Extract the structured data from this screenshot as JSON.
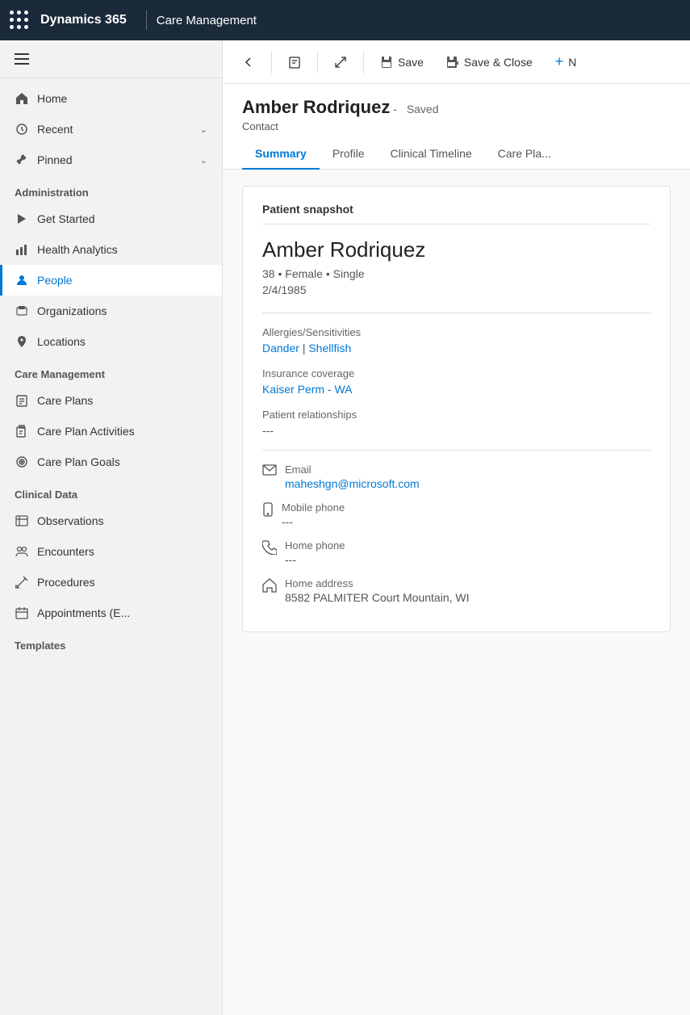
{
  "topbar": {
    "app_title": "Dynamics 365",
    "module_title": "Care Management"
  },
  "toolbar": {
    "back_label": "",
    "view_label": "",
    "expand_label": "",
    "save_label": "Save",
    "save_close_label": "Save & Close",
    "new_label": "N"
  },
  "record": {
    "name": "Amber Rodriquez",
    "status": "Saved",
    "type": "Contact"
  },
  "tabs": [
    {
      "id": "summary",
      "label": "Summary",
      "active": true
    },
    {
      "id": "profile",
      "label": "Profile",
      "active": false
    },
    {
      "id": "clinical_timeline",
      "label": "Clinical Timeline",
      "active": false
    },
    {
      "id": "care_plan",
      "label": "Care Pla...",
      "active": false
    }
  ],
  "sidebar": {
    "sections": [
      {
        "type": "nav",
        "items": [
          {
            "id": "home",
            "label": "Home",
            "icon": "home-icon"
          },
          {
            "id": "recent",
            "label": "Recent",
            "icon": "recent-icon",
            "hasChevron": true
          },
          {
            "id": "pinned",
            "label": "Pinned",
            "icon": "pin-icon",
            "hasChevron": true
          }
        ]
      },
      {
        "type": "section",
        "header": "Administration",
        "items": [
          {
            "id": "get-started",
            "label": "Get Started",
            "icon": "play-icon"
          },
          {
            "id": "health-analytics",
            "label": "Health Analytics",
            "icon": "analytics-icon"
          },
          {
            "id": "people",
            "label": "People",
            "icon": "person-icon",
            "active": true
          },
          {
            "id": "organizations",
            "label": "Organizations",
            "icon": "org-icon"
          },
          {
            "id": "locations",
            "label": "Locations",
            "icon": "location-icon"
          }
        ]
      },
      {
        "type": "section",
        "header": "Care Management",
        "items": [
          {
            "id": "care-plans",
            "label": "Care Plans",
            "icon": "careplan-icon"
          },
          {
            "id": "care-plan-activities",
            "label": "Care Plan Activities",
            "icon": "activity-icon"
          },
          {
            "id": "care-plan-goals",
            "label": "Care Plan Goals",
            "icon": "goal-icon"
          }
        ]
      },
      {
        "type": "section",
        "header": "Clinical Data",
        "items": [
          {
            "id": "observations",
            "label": "Observations",
            "icon": "obs-icon"
          },
          {
            "id": "encounters",
            "label": "Encounters",
            "icon": "encounter-icon"
          },
          {
            "id": "procedures",
            "label": "Procedures",
            "icon": "procedure-icon"
          },
          {
            "id": "appointments",
            "label": "Appointments (E...",
            "icon": "appt-icon"
          }
        ]
      },
      {
        "type": "section",
        "header": "Templates",
        "items": []
      }
    ]
  },
  "patient_snapshot": {
    "section_title": "Patient snapshot",
    "name": "Amber Rodriquez",
    "age": "38",
    "gender": "Female",
    "marital": "Single",
    "dob": "2/4/1985",
    "allergies_label": "Allergies/Sensitivities",
    "allergies": [
      {
        "name": "Dander"
      },
      {
        "name": "Shellfish"
      }
    ],
    "insurance_label": "Insurance coverage",
    "insurance": "Kaiser Perm - WA",
    "relationships_label": "Patient relationships",
    "relationships": "---",
    "email_label": "Email",
    "email": "maheshgn@microsoft.com",
    "mobile_label": "Mobile phone",
    "mobile": "---",
    "home_phone_label": "Home phone",
    "home_phone": "---",
    "home_address_label": "Home address",
    "home_address": "8582 PALMITER Court Mountain, WI"
  }
}
